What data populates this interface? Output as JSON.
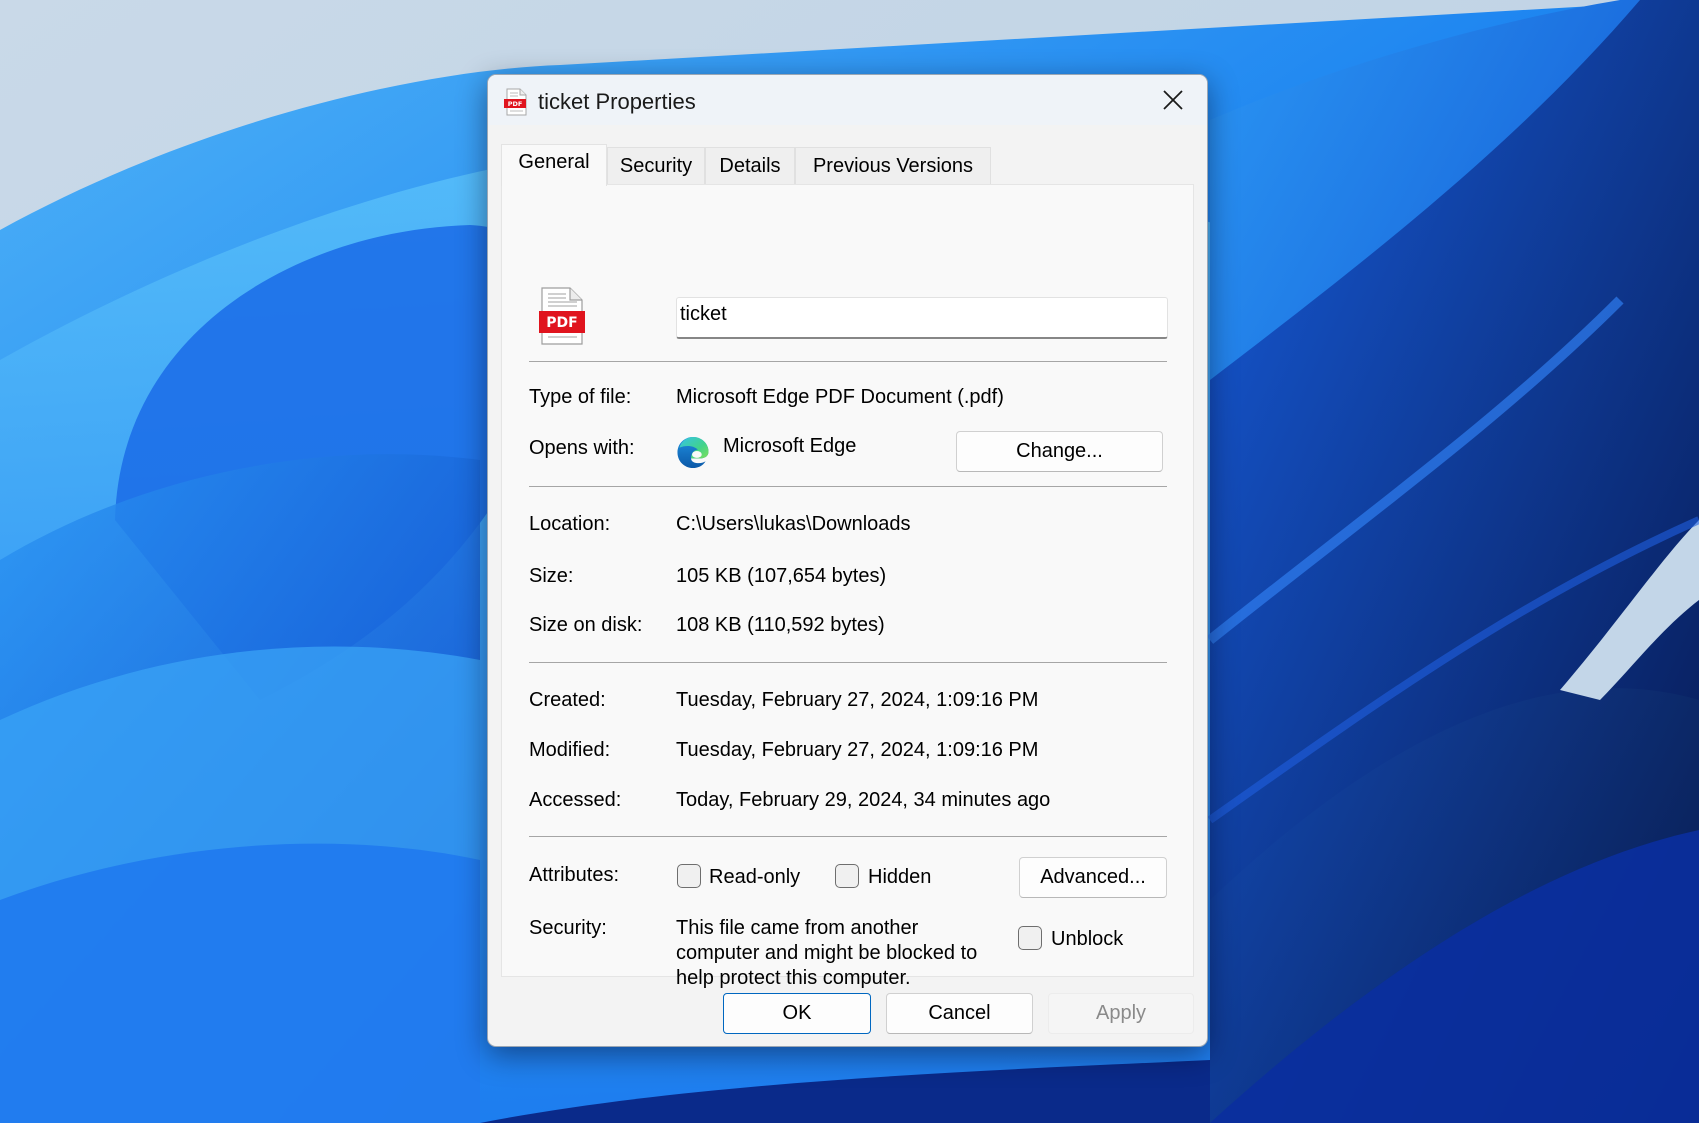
{
  "dialog": {
    "title": "ticket Properties",
    "title_icon": "pdf-file-icon",
    "close_icon": "close-icon"
  },
  "tabs": [
    {
      "label": "General",
      "active": true
    },
    {
      "label": "Security",
      "active": false
    },
    {
      "label": "Details",
      "active": false
    },
    {
      "label": "Previous Versions",
      "active": false
    }
  ],
  "general": {
    "file_icon": "pdf-document-icon",
    "file_icon_badge": "PDF",
    "file_name": "ticket",
    "rows": {
      "type_of_file": {
        "label": "Type of file:",
        "value": "Microsoft Edge PDF Document (.pdf)"
      },
      "opens_with": {
        "label": "Opens with:",
        "value": "Microsoft Edge",
        "icon": "microsoft-edge-icon",
        "button": "Change..."
      },
      "location": {
        "label": "Location:",
        "value": "C:\\Users\\lukas\\Downloads"
      },
      "size": {
        "label": "Size:",
        "value": "105 KB (107,654 bytes)"
      },
      "size_on_disk": {
        "label": "Size on disk:",
        "value": "108 KB (110,592 bytes)"
      },
      "created": {
        "label": "Created:",
        "value": "Tuesday, February 27, 2024, 1:09:16 PM"
      },
      "modified": {
        "label": "Modified:",
        "value": "Tuesday, February 27, 2024, 1:09:16 PM"
      },
      "accessed": {
        "label": "Accessed:",
        "value": "Today, February 29, 2024, 34 minutes ago"
      }
    },
    "attributes": {
      "label": "Attributes:",
      "read_only": {
        "label": "Read-only",
        "checked": false
      },
      "hidden": {
        "label": "Hidden",
        "checked": false
      },
      "advanced_button": "Advanced..."
    },
    "security": {
      "label": "Security:",
      "lines": [
        "This file came from another",
        "computer and might be blocked to",
        "help protect this computer."
      ],
      "unblock": {
        "label": "Unblock",
        "checked": false
      }
    }
  },
  "footer": {
    "ok": "OK",
    "cancel": "Cancel",
    "apply": "Apply",
    "apply_disabled": true
  },
  "colors": {
    "accent": "#0067c0",
    "pdf_red": "#e0141e",
    "dialog_bg": "#f3f3f3",
    "panel_bg": "#f9f9f9"
  }
}
